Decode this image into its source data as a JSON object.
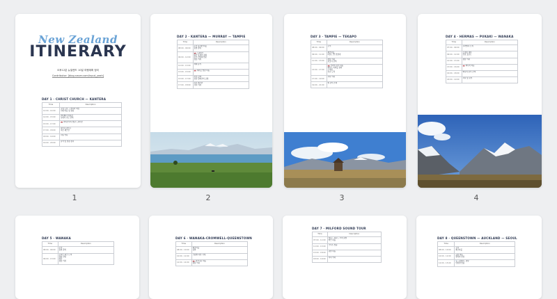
{
  "page_numbers": [
    "1",
    "2",
    "3",
    "4"
  ],
  "table_headers": {
    "time": "Time",
    "description": "Description"
  },
  "cover": {
    "title_script": "New Zealand",
    "title_main": "ITINERARY",
    "subtitle": "오후12분 뉴질랜드 10일 여행계획 정리",
    "contributor": "Contributor: [blog.naver.com/input_yeah]"
  },
  "pages": [
    {
      "day": "DAY 1 · CHRIST CHURCH — KANTERA",
      "rows": [
        {
          "time": "12:00 - 14:00",
          "desc": "공항 도착 → 렌터카 픽업\n시내 이동 및 점심"
        },
        {
          "time": "14:00 - 15:00",
          "desc": "캔터베리 박물관\n보태닉 가든 산책"
        },
        {
          "time": "15:00 - 17:00",
          "desc": "🚗 카이코우라 방향 드라이브"
        },
        {
          "time": "17:00 - 18:00",
          "desc": "장보기 (마트)\n숙소 체크인"
        },
        {
          "time": "18:00 - 19:00",
          "desc": "저녁 식사"
        },
        {
          "time": "19:00 - 20:00",
          "desc": "휴식 및 일정 정리"
        }
      ]
    },
    {
      "day": "DAY 2 · KANTERA — MURRAY — TAMPIE",
      "rows": [
        {
          "time": "08:00 - 09:00",
          "desc": "조식 및 체크아웃\n출발 준비"
        },
        {
          "time": "09:00 - 12:00",
          "desc": "🚗 드라이브\n중간 휴게소 정차\n호수 전망대 방문\n점심 식사"
        },
        {
          "time": "12:00 - 13:00",
          "desc": "카페 휴식"
        },
        {
          "time": "13:00 - 15:00",
          "desc": "🚗 테카포 방향 이동"
        },
        {
          "time": "15:00 - 17:00",
          "desc": "호수 산책\n선한 양치기의 교회"
        },
        {
          "time": "17:00 - 18:00",
          "desc": "숙소 체크인\n저녁 식사"
        }
      ]
    },
    {
      "day": "DAY 3 · TAMPIE — TEKAPO",
      "rows": [
        {
          "time": "08:00 - 09:00",
          "desc": "조식"
        },
        {
          "time": "09:00 - 11:00",
          "desc": "체크아웃\n마운트 존 전망대"
        },
        {
          "time": "11:00 - 13:00",
          "desc": "점심 식사\n호숫가 산책"
        },
        {
          "time": "13:00 - 17:00",
          "desc": "🚗 푸카키 호수 이동\n피터스 룩아웃 정차\n트레킹\n숙소 도착"
        },
        {
          "time": "17:00 - 19:00",
          "desc": "저녁 식사"
        },
        {
          "time": "19:00 - 21:00",
          "desc": "별 관측 투어"
        }
      ]
    },
    {
      "day": "DAY 4 · HERMAS — PUKAKI — WANAKA",
      "rows": [
        {
          "time": "07:00 - 09:00",
          "desc": "후커밸리 트랙"
        },
        {
          "time": "09:00 - 12:00",
          "desc": "트레킹 계속\n전망 포인트"
        },
        {
          "time": "12:00 - 13:00",
          "desc": "점심 식사"
        },
        {
          "time": "13:00 - 16:00",
          "desc": "🚗 와나카 이동"
        },
        {
          "time": "16:00 - 18:00",
          "desc": "와나카 호수 산책"
        },
        {
          "time": "18:00 - 19:00",
          "desc": "저녁 및 휴식"
        }
      ]
    },
    {
      "day": "DAY 5 · WANAKA",
      "rows": [
        {
          "time": "08:00 - 09:00",
          "desc": "조식\n출발 준비"
        },
        {
          "time": "09:00 - 13:00",
          "desc": "로이스 피크 트랙\n정상 전망\n하산\n점심 식사"
        }
      ]
    },
    {
      "day": "DAY 6 · WANAKA-CROMWELL-QUEENSTOWN",
      "rows": [
        {
          "time": "08:00 - 10:00",
          "desc": "체크아웃\n출발"
        },
        {
          "time": "10:00 - 12:00",
          "desc": "크롬웰 과일 가게"
        },
        {
          "time": "12:00 - 14:00",
          "desc": "🚗 퀸스타운 이동\n점심 식사"
        }
      ]
    },
    {
      "day": "DAY 7 · MILFORD SOUND TOUR",
      "rows": [
        {
          "time": "07:00 - 11:00",
          "desc": "밀포드 사운드 투어 출발\n버스 이동"
        },
        {
          "time": "11:00 - 13:00",
          "desc": "크루즈 탑승"
        },
        {
          "time": "13:00 - 18:00",
          "desc": "귀환 이동"
        },
        {
          "time": "18:00 - 19:00",
          "desc": "저녁 식사"
        }
      ]
    },
    {
      "day": "DAY 8 · QUEENSTOWN — AUCKLAND — SEOUL",
      "rows": [
        {
          "time": "08:00 - 10:00",
          "desc": "조식\n체크아웃"
        },
        {
          "time": "10:00 - 12:00",
          "desc": "공항 이동\n렌터카 반납"
        },
        {
          "time": "12:00 - 15:00",
          "desc": "🛫 오클랜드 경유\n인천행 탑승"
        }
      ]
    }
  ],
  "colors": {
    "background": "#eeeff1",
    "title_script": "#6aa3d6",
    "title_main": "#2b3650",
    "sky_blue": "#3f7fd0"
  }
}
